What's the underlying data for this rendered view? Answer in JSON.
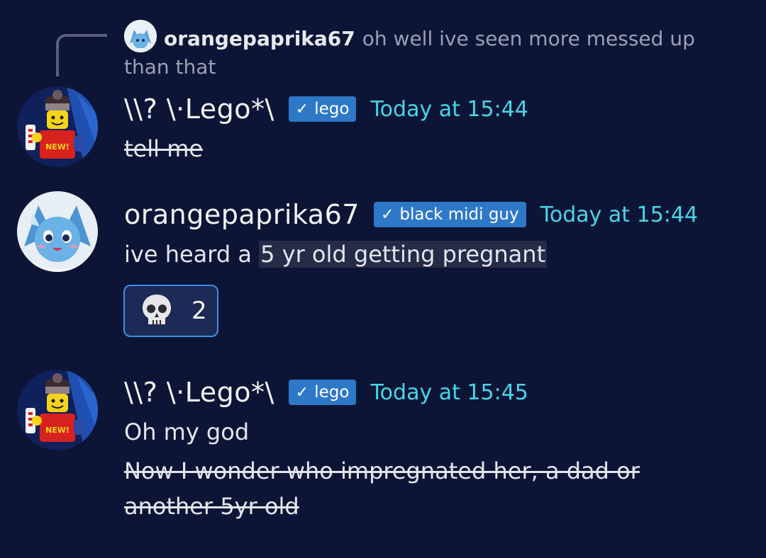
{
  "reply": {
    "author": "orangepaprika67",
    "text": "oh well ive seen more messed up than that"
  },
  "messages": [
    {
      "author": "\\\\? \\·Lego*\\",
      "role_badge": "lego",
      "timestamp": "Today at 15:44",
      "lines": [
        "tell me"
      ]
    },
    {
      "author": "orangepaprika67",
      "role_badge": "black midi guy",
      "timestamp": "Today at 15:44",
      "text_before": "ive heard a ",
      "text_highlighted": "5 yr old getting pregnant",
      "reaction": {
        "emoji": "skull-icon",
        "count": "2"
      }
    },
    {
      "author": "\\\\? \\·Lego*\\",
      "role_badge": "lego",
      "timestamp": "Today at 15:45",
      "lines": [
        "Oh my god",
        "Now I wonder who impregnated her, a dad or another 5yr old"
      ]
    }
  ],
  "colors": {
    "background": "#0d1536",
    "timestamp": "#48d6e6",
    "badge": "#2e78c8",
    "reaction_border": "#3e8ee6"
  }
}
